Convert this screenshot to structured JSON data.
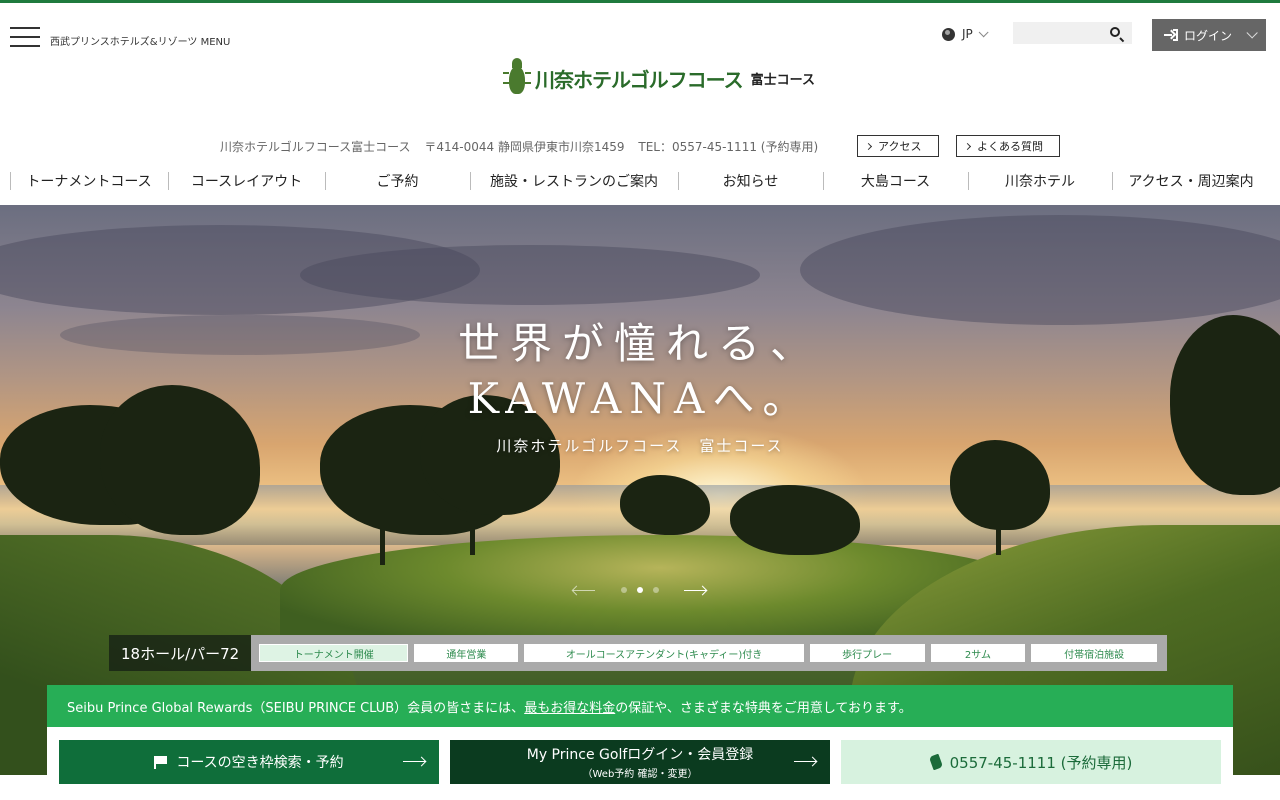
{
  "header": {
    "menu_label": "西武プリンスホテルズ&リゾーツ MENU",
    "lang": "JP",
    "search_placeholder": "",
    "login_label": "ログイン",
    "logo_text": "川奈ホテルゴルフコース",
    "logo_sub": "富士コース"
  },
  "info": {
    "name": "川奈ホテルゴルフコース富士コース",
    "address": "〒414-0044 静岡県伊東市川奈1459",
    "tel": "TEL：0557-45-1111 (予約専用)",
    "access_btn": "アクセス",
    "faq_btn": "よくある質問"
  },
  "nav": [
    "トーナメントコース",
    "コースレイアウト",
    "ご予約",
    "施設・レストランのご案内",
    "お知らせ",
    "大島コース",
    "川奈ホテル",
    "アクセス・周辺案内"
  ],
  "hero": {
    "title_line1": "世界が憧れる、",
    "title_line2": "KAWANAへ。",
    "subtitle": "川奈ホテルゴルフコース　富士コース",
    "slide_count": 3,
    "active_slide": 2
  },
  "features": {
    "label": "18ホール/パー72",
    "tags": [
      "トーナメント開催",
      "通年営業",
      "オールコースアテンダント(キャディー)付き",
      "歩行プレー",
      "2サム",
      "付帯宿泊施設"
    ]
  },
  "rewards": {
    "prefix": "Seibu Prince Global Rewards（SEIBU PRINCE CLUB）会員の皆さまには、",
    "link": "最もお得な料金",
    "suffix": "の保証や、さまざまな特典をご用意しております。"
  },
  "cta": {
    "search_label": "コースの空き枠検索・予約",
    "mypg_main": "My Prince Golfログイン・会員登録",
    "mypg_sub": "（Web予約 確認・変更）",
    "phone_label": "0557-45-1111 (予約専用)"
  },
  "colors": {
    "brand_green": "#27ae56",
    "dark_green": "#0f6e3a",
    "darker_green": "#0b3b1f",
    "light_green": "#d7f2df"
  }
}
